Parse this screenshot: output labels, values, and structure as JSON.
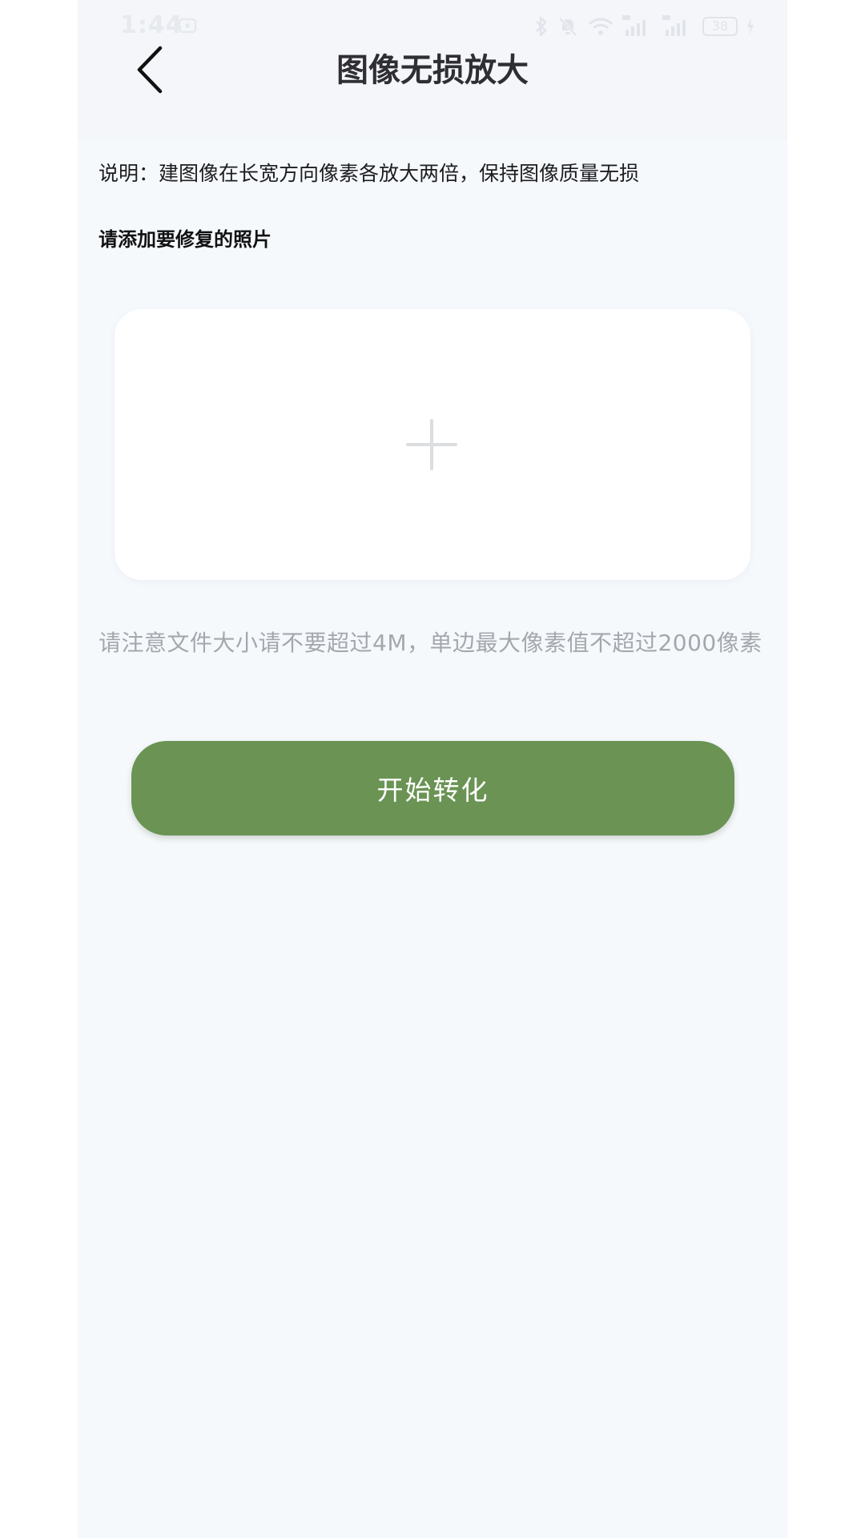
{
  "status_bar": {
    "time": "1:44",
    "battery": "38"
  },
  "header": {
    "back_icon": "chevron-left-icon",
    "title": "图像无损放大"
  },
  "content": {
    "description": "说明：建图像在长宽方向像素各放大两倍，保持图像质量无损",
    "section_label": "请添加要修复的照片",
    "upload_icon": "plus-icon",
    "notice": "请注意文件大小请不要超过4M，单边最大像素值不超过2000像素",
    "start_button": "开始转化"
  },
  "colors": {
    "primary_button": "#6a9354",
    "page_background": "#f6f9fc",
    "header_background": "#f4f6f9",
    "card_background": "#ffffff",
    "notice_text": "#a4a7ad"
  }
}
